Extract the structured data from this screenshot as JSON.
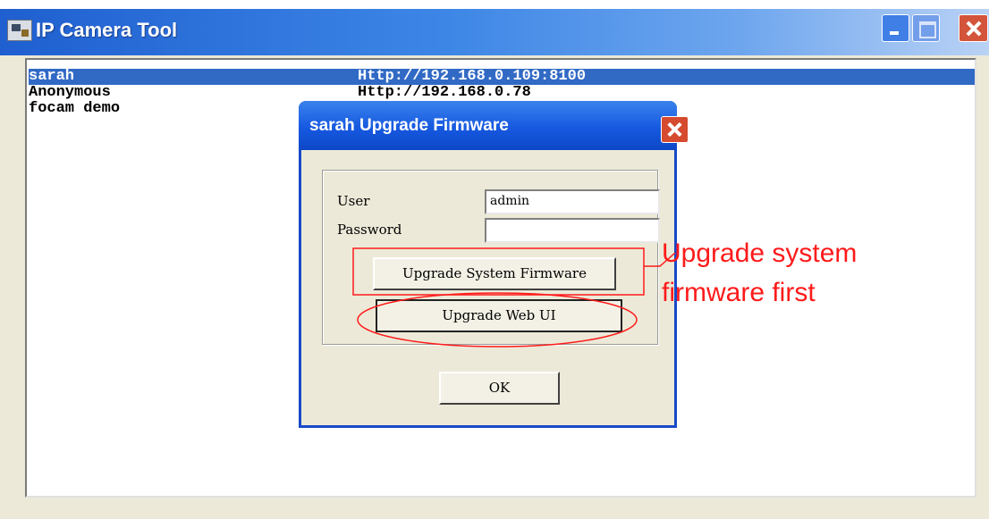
{
  "window": {
    "title": "IP Camera Tool"
  },
  "devices": [
    {
      "name": "sarah",
      "url": "Http://192.168.0.109:8100",
      "selected": true
    },
    {
      "name": "Anonymous",
      "url": "Http://192.168.0.78",
      "selected": false
    },
    {
      "name": "focam demo",
      "url": "",
      "selected": false
    }
  ],
  "dialog": {
    "title": "sarah Upgrade Firmware",
    "user_label": "User",
    "user_value": "admin",
    "password_label": "Password",
    "password_value": "",
    "upgrade_system_label": "Upgrade System Firmware",
    "upgrade_webui_label": "Upgrade Web UI",
    "ok_label": "OK"
  },
  "annotation": {
    "text_line1": "Upgrade system",
    "text_line2": "firmware first",
    "color": "#ff1a1a"
  },
  "colors": {
    "selection": "#316AC5",
    "dialog_face": "#ECE9D8",
    "titlebar_blue": "#1f5fd0"
  }
}
